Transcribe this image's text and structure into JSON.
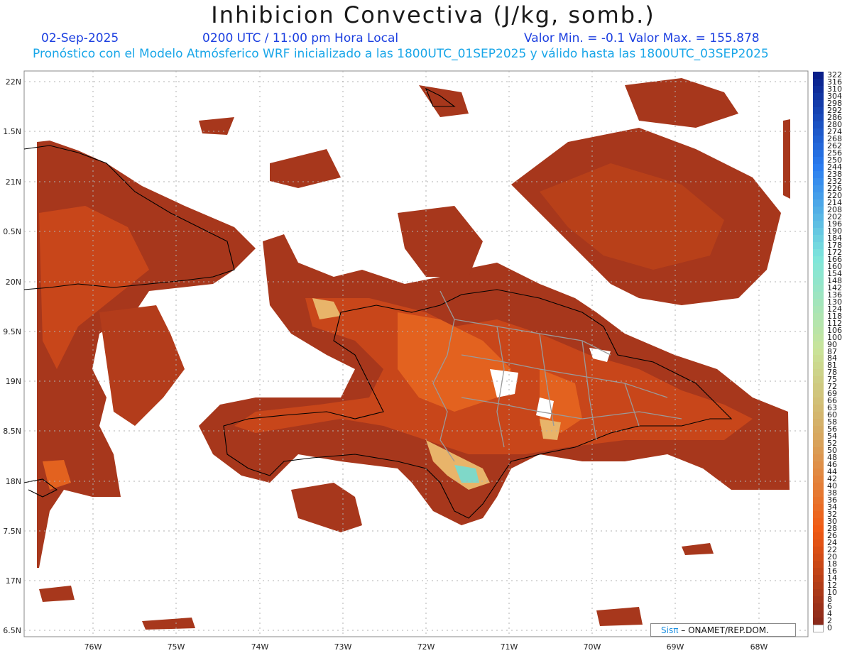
{
  "header": {
    "title": "Inhibicion Convectiva (J/kg, somb.)",
    "date": "02-Sep-2025",
    "time": "0200 UTC / 11:00 pm Hora Local",
    "minmax": "Valor Min. = -0.1  Valor Max. = 155.878",
    "forecast": "Pronóstico con el Modelo Atmósferico WRF inicializado a las 1800UTC_01SEP2025 y válido hasta las  1800UTC_03SEP2025"
  },
  "axes": {
    "lat_labels": [
      "22N",
      "1.5N",
      "21N",
      "0.5N",
      "20N",
      "9.5N",
      "19N",
      "8.5N",
      "18N",
      "7.5N",
      "17N",
      "6.5N"
    ],
    "lon_labels": [
      "76W",
      "75W",
      "74W",
      "73W",
      "72W",
      "71W",
      "70W",
      "69W",
      "68W"
    ]
  },
  "colorbar": {
    "labels": [
      "322",
      "316",
      "310",
      "304",
      "298",
      "292",
      "286",
      "280",
      "274",
      "268",
      "262",
      "256",
      "250",
      "244",
      "238",
      "232",
      "226",
      "220",
      "214",
      "208",
      "202",
      "196",
      "190",
      "184",
      "178",
      "172",
      "166",
      "160",
      "154",
      "148",
      "142",
      "136",
      "130",
      "124",
      "118",
      "112",
      "106",
      "100",
      "90",
      "87",
      "84",
      "81",
      "78",
      "75",
      "72",
      "69",
      "66",
      "63",
      "60",
      "58",
      "56",
      "54",
      "52",
      "50",
      "48",
      "46",
      "44",
      "42",
      "40",
      "38",
      "36",
      "34",
      "32",
      "30",
      "28",
      "26",
      "24",
      "22",
      "20",
      "18",
      "16",
      "14",
      "12",
      "10",
      "8",
      "6",
      "4",
      "2",
      "0"
    ],
    "colors": {
      "dark_blue": "#0a1f8a",
      "blue": "#2a7cf0",
      "cyan": "#7ee6dc",
      "green_yellow": "#c9e49a",
      "tan": "#d8a65e",
      "orange": "#f05a14",
      "brown": "#8b2a1a"
    }
  },
  "map": {
    "field_colors": {
      "base": "#a7371c",
      "mid": "#c8461a",
      "hot": "#e3621f",
      "peak": "#e8b46a",
      "max": "#7fd8c8"
    },
    "coast_color": "#000000",
    "border_color": "#9a9a9a"
  },
  "credit": {
    "brand": "Sisπ",
    "text": " – ONAMET/REP.DOM."
  }
}
